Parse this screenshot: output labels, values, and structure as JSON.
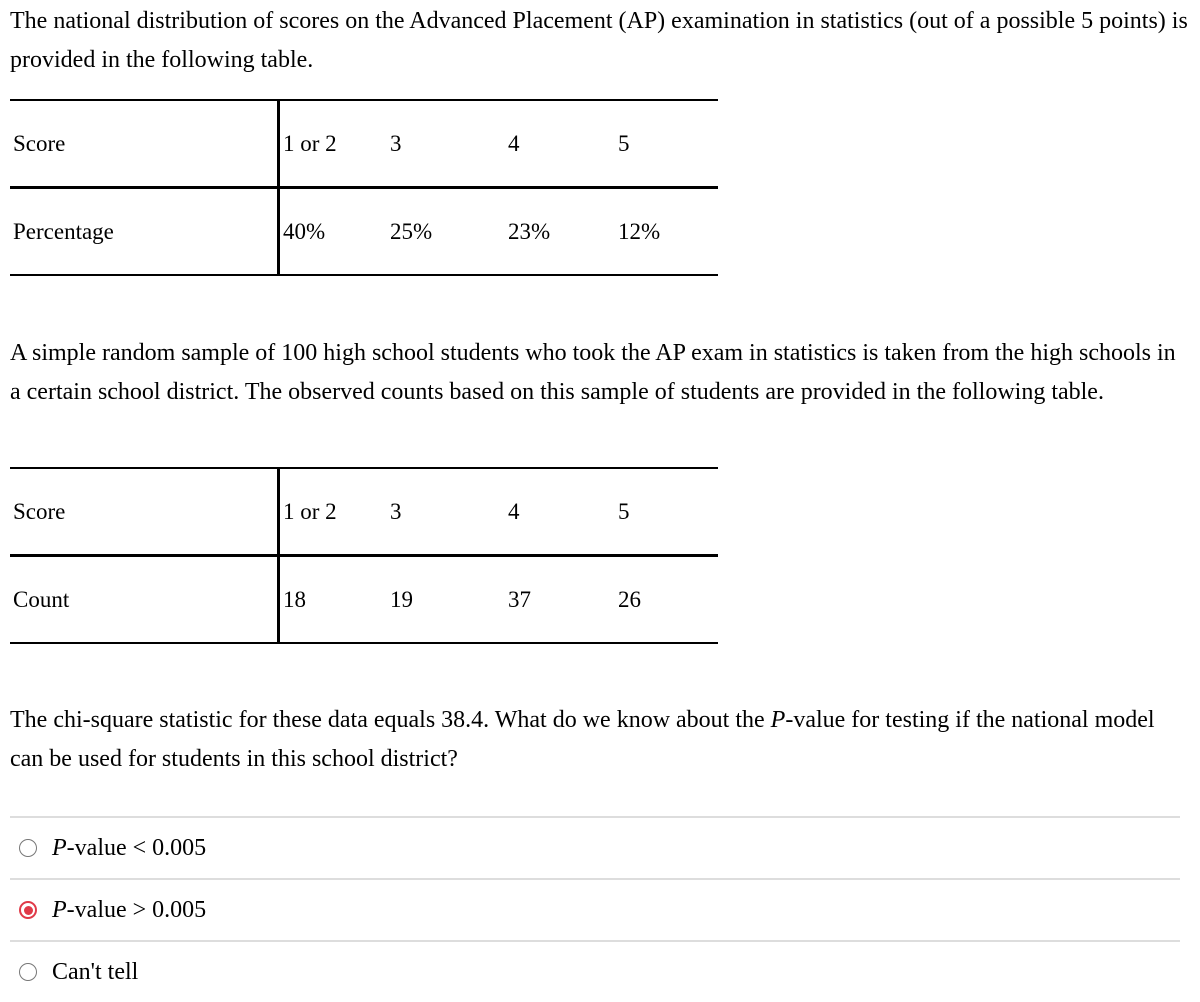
{
  "intro": {
    "text": "The national distribution of scores on the Advanced Placement (AP) examination in statistics (out of a possible 5 points) is provided in the following table."
  },
  "national_table": {
    "row_headers": [
      "Score",
      "Percentage"
    ],
    "scores": [
      "1 or 2",
      "3",
      "4",
      "5"
    ],
    "percentages": [
      "40%",
      "25%",
      "23%",
      "12%"
    ]
  },
  "sample": {
    "text": "A simple random sample of 100 high school students who took the AP exam in statistics is taken from the high schools in a certain school district. The observed counts based on this sample of students are provided in the following table."
  },
  "sample_table": {
    "row_headers": [
      "Score",
      "Count"
    ],
    "scores": [
      "1 or 2",
      "3",
      "4",
      "5"
    ],
    "counts": [
      "18",
      "19",
      "37",
      "26"
    ]
  },
  "question": {
    "before_italic": "The chi-square statistic for these data equals 38.4. What do we know about the ",
    "italic": "P",
    "after_italic": "-value for testing if the national model can be used for students in this school district?"
  },
  "options": [
    {
      "italic": "P",
      "text": "-value < 0.005",
      "selected": false
    },
    {
      "italic": "P",
      "text": "-value > 0.005",
      "selected": true
    },
    {
      "italic": "",
      "text": "Can't tell",
      "selected": false
    }
  ],
  "colors": {
    "selected_radio": "#e03a48",
    "divider": "#dddddd"
  }
}
